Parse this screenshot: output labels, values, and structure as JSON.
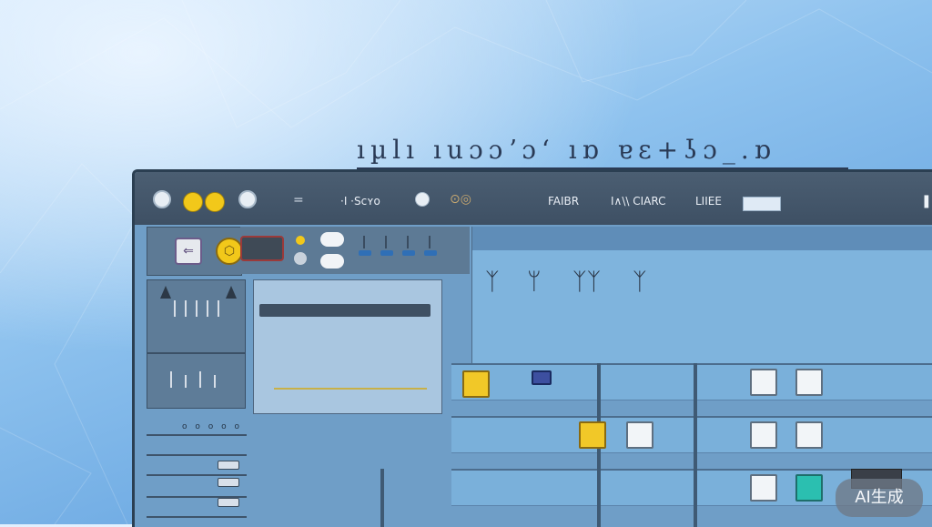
{
  "garbled_heading": "ıµlı  ıuɔɔʼɔʻ  ıɒ ɐɛ+ʖɔ_.ɒ",
  "titlebar": {
    "label_1": "·I ·Sᴄʏᴏ",
    "label_2": "FAIBR",
    "label_3": "I∧\\\\ CIARC",
    "label_4": "LIIEE",
    "menu_glyph": "=",
    "search_glyph": "⊙◎",
    "pause_glyph": "❚❚"
  },
  "toolbar": {
    "tool_glyphs": [
      "⇐",
      "⬡"
    ]
  },
  "left_panel": {
    "dots": "o o o o o"
  },
  "music_symbols": [
    "ᛉ",
    "ᛘ",
    "ᛉᛉ",
    "ᛉ"
  ],
  "badge": {
    "text": "AI生成"
  },
  "colors": {
    "accent_yellow": "#f2c81a",
    "teal": "#2bbfb0",
    "titlebar": "#3e5064"
  }
}
